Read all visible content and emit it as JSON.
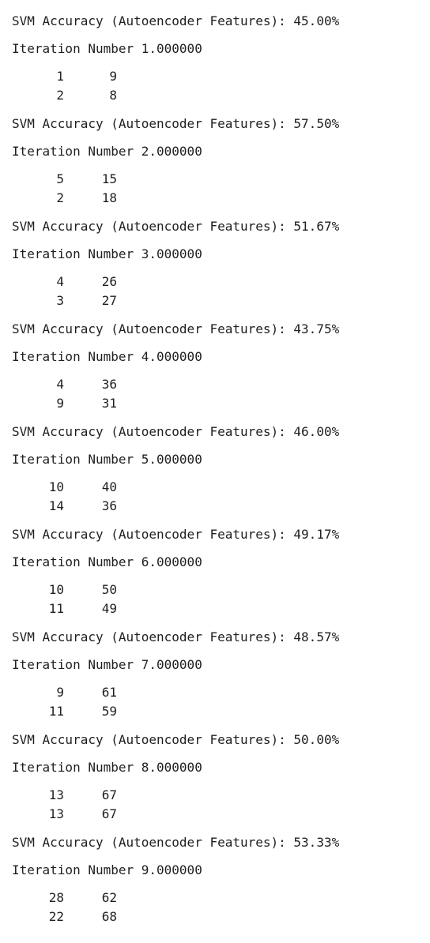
{
  "output": [
    {
      "accuracy": "SVM Accuracy (Autoencoder Features): 45.00%",
      "iteration": "Iteration Number 1.000000",
      "matrix": [
        [
          "1",
          "9"
        ],
        [
          "2",
          "8"
        ]
      ]
    },
    {
      "accuracy": "SVM Accuracy (Autoencoder Features): 57.50%",
      "iteration": "Iteration Number 2.000000",
      "matrix": [
        [
          "5",
          "15"
        ],
        [
          "2",
          "18"
        ]
      ]
    },
    {
      "accuracy": "SVM Accuracy (Autoencoder Features): 51.67%",
      "iteration": "Iteration Number 3.000000",
      "matrix": [
        [
          "4",
          "26"
        ],
        [
          "3",
          "27"
        ]
      ]
    },
    {
      "accuracy": "SVM Accuracy (Autoencoder Features): 43.75%",
      "iteration": "Iteration Number 4.000000",
      "matrix": [
        [
          "4",
          "36"
        ],
        [
          "9",
          "31"
        ]
      ]
    },
    {
      "accuracy": "SVM Accuracy (Autoencoder Features): 46.00%",
      "iteration": "Iteration Number 5.000000",
      "matrix": [
        [
          "10",
          "40"
        ],
        [
          "14",
          "36"
        ]
      ]
    },
    {
      "accuracy": "SVM Accuracy (Autoencoder Features): 49.17%",
      "iteration": "Iteration Number 6.000000",
      "matrix": [
        [
          "10",
          "50"
        ],
        [
          "11",
          "49"
        ]
      ]
    },
    {
      "accuracy": "SVM Accuracy (Autoencoder Features): 48.57%",
      "iteration": "Iteration Number 7.000000",
      "matrix": [
        [
          "9",
          "61"
        ],
        [
          "11",
          "59"
        ]
      ]
    },
    {
      "accuracy": "SVM Accuracy (Autoencoder Features): 50.00%",
      "iteration": "Iteration Number 8.000000",
      "matrix": [
        [
          "13",
          "67"
        ],
        [
          "13",
          "67"
        ]
      ]
    },
    {
      "accuracy": "SVM Accuracy (Autoencoder Features): 53.33%",
      "iteration": "Iteration Number 9.000000",
      "matrix": [
        [
          "28",
          "62"
        ],
        [
          "22",
          "68"
        ]
      ]
    }
  ]
}
